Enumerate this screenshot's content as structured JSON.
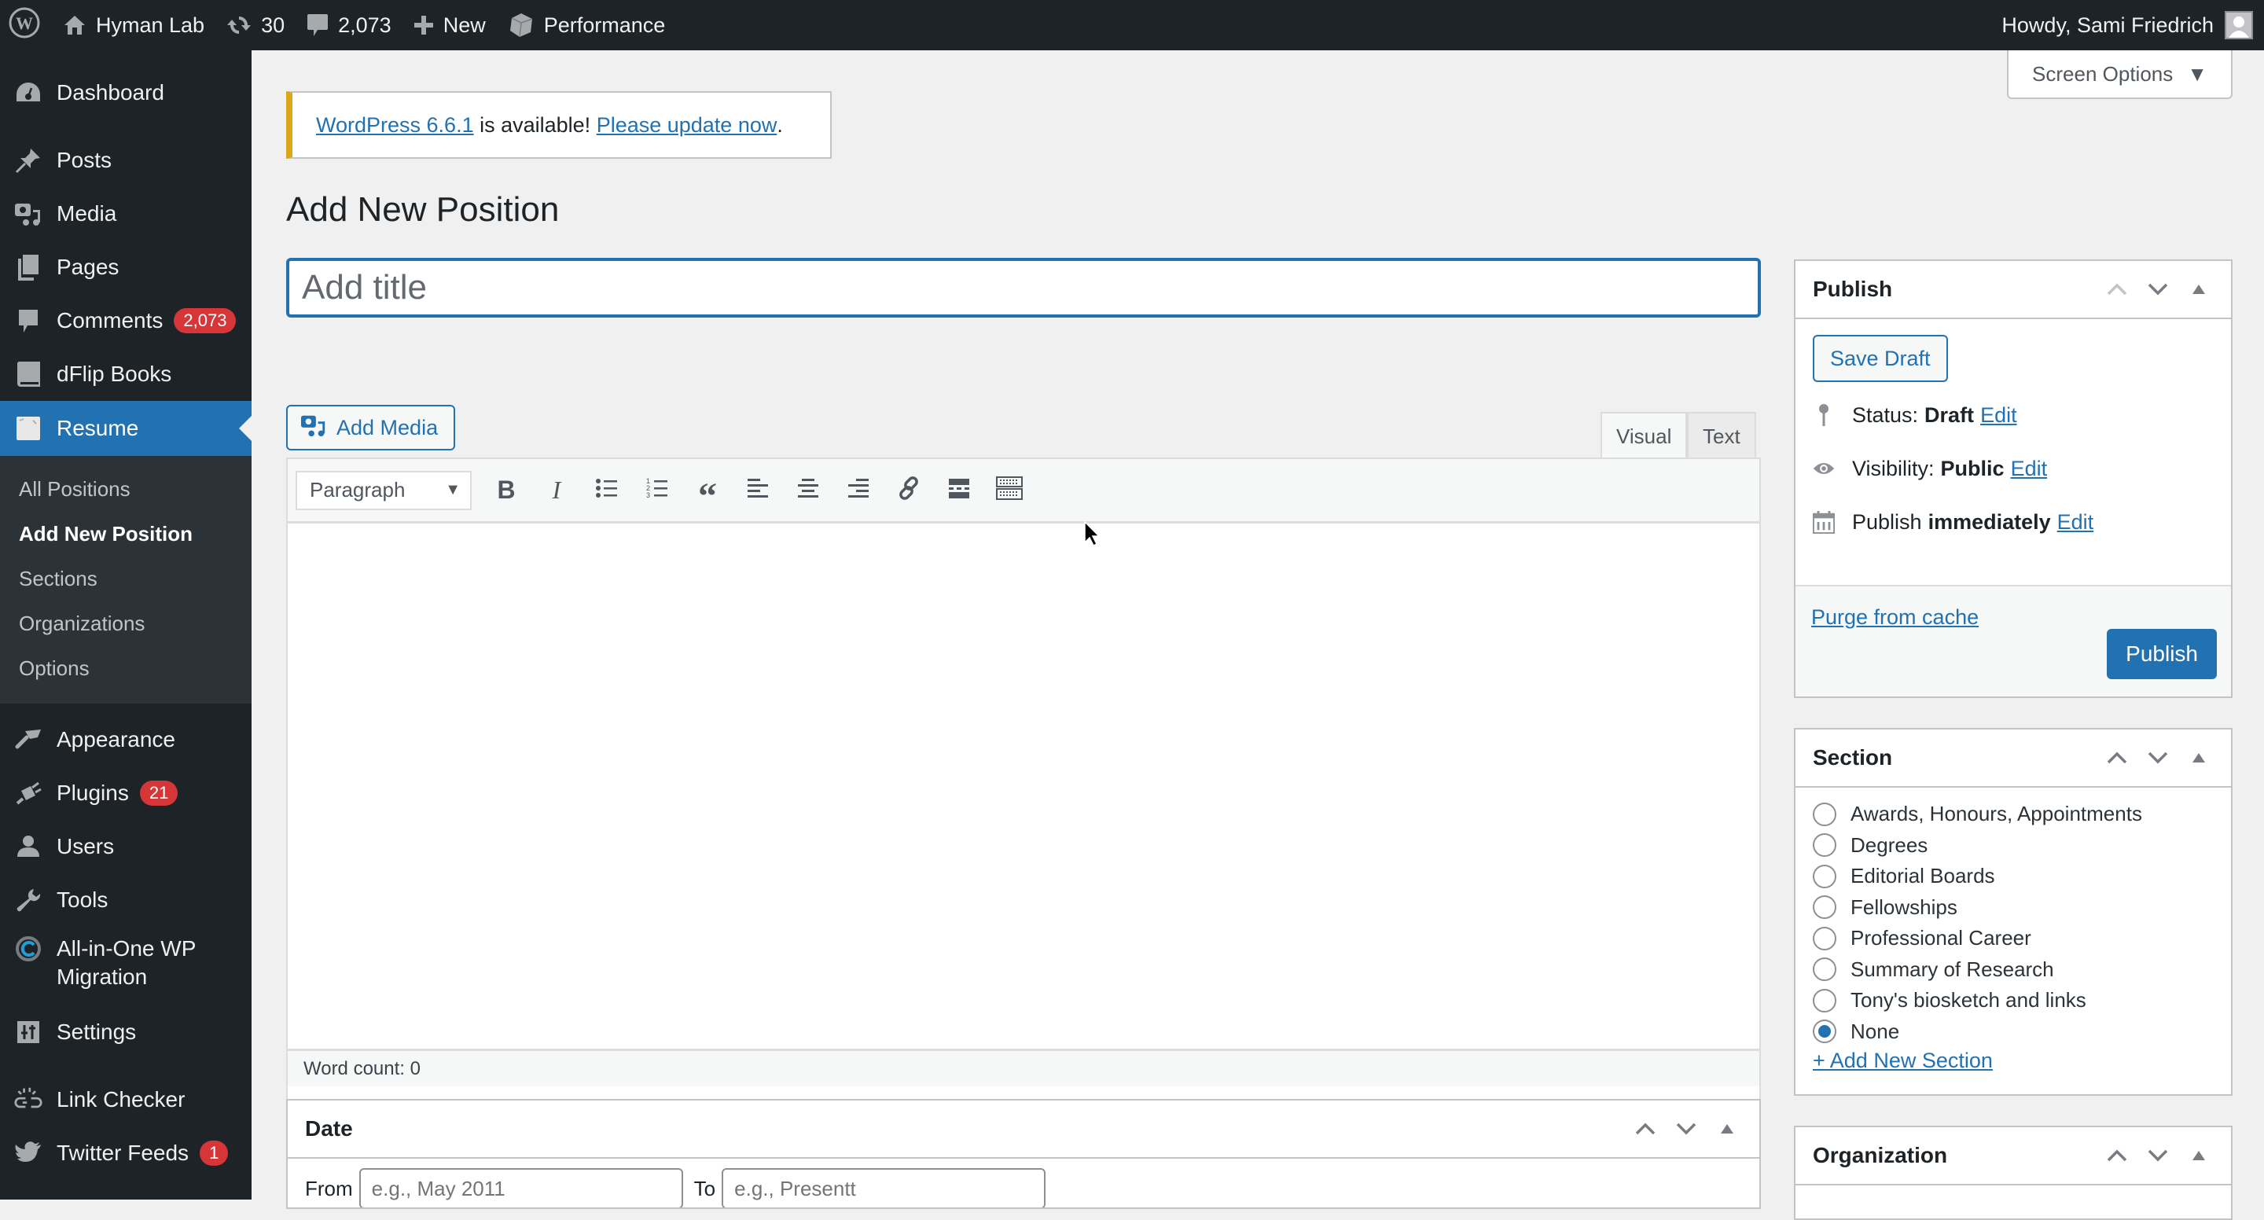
{
  "adminbar": {
    "site_name": "Hyman Lab",
    "updates_count": "30",
    "comments_count": "2,073",
    "new_label": "New",
    "performance_label": "Performance",
    "howdy": "Howdy, Sami Friedrich"
  },
  "sidebar": {
    "items": [
      {
        "label": "Dashboard",
        "icon": "dashboard-icon"
      },
      {
        "label": "Posts",
        "icon": "pushpin-icon"
      },
      {
        "label": "Media",
        "icon": "media-icon"
      },
      {
        "label": "Pages",
        "icon": "pages-icon"
      },
      {
        "label": "Comments",
        "icon": "comment-icon",
        "badge": "2,073"
      },
      {
        "label": "dFlip Books",
        "icon": "book-icon"
      },
      {
        "label": "Resume",
        "icon": "resume-icon",
        "current": true
      },
      {
        "label": "Appearance",
        "icon": "paintbrush-icon"
      },
      {
        "label": "Plugins",
        "icon": "plugin-icon",
        "badge": "21"
      },
      {
        "label": "Users",
        "icon": "user-icon"
      },
      {
        "label": "Tools",
        "icon": "wrench-icon"
      },
      {
        "label": "All-in-One WP Migration",
        "icon": "migration-icon"
      },
      {
        "label": "Settings",
        "icon": "settings-icon"
      },
      {
        "label": "Link Checker",
        "icon": "broken-link-icon"
      },
      {
        "label": "Twitter Feeds",
        "icon": "twitter-icon",
        "badge": "1"
      }
    ],
    "resume_submenu": [
      {
        "label": "All Positions"
      },
      {
        "label": "Add New Position",
        "active": true
      },
      {
        "label": "Sections"
      },
      {
        "label": "Organizations"
      },
      {
        "label": "Options"
      }
    ]
  },
  "screen_options": "Screen Options",
  "notice": {
    "link1": "WordPress 6.6.1",
    "text": " is available! ",
    "link2": "Please update now",
    "end": "."
  },
  "page_title": "Add New Position",
  "title_input": {
    "placeholder": "Add title",
    "value": ""
  },
  "editor": {
    "add_media": "Add Media",
    "tabs": [
      {
        "label": "Visual",
        "active": true
      },
      {
        "label": "Text"
      }
    ],
    "format_select": "Paragraph",
    "toolbar_buttons": [
      "bold",
      "italic",
      "bulleted-list",
      "numbered-list",
      "blockquote",
      "align-left",
      "align-center",
      "align-right",
      "insert-link",
      "read-more",
      "toolbar-toggle"
    ],
    "word_count": "Word count: 0"
  },
  "date_box": {
    "title": "Date",
    "from_label": "From",
    "from_placeholder": "e.g., May 2011",
    "to_label": "To",
    "to_placeholder": "e.g., Presentt"
  },
  "publish_box": {
    "title": "Publish",
    "save_draft": "Save Draft",
    "status_label": "Status:",
    "status_value": "Draft",
    "visibility_label": "Visibility:",
    "visibility_value": "Public",
    "schedule_label": "Publish",
    "schedule_value": "immediately",
    "edit": "Edit",
    "purge": "Purge from cache",
    "publish_button": "Publish"
  },
  "section_box": {
    "title": "Section",
    "options": [
      {
        "label": "Awards, Honours, Appointments",
        "checked": false
      },
      {
        "label": "Degrees",
        "checked": false
      },
      {
        "label": "Editorial Boards",
        "checked": false
      },
      {
        "label": "Fellowships",
        "checked": false
      },
      {
        "label": "Professional Career",
        "checked": false
      },
      {
        "label": "Summary of Research",
        "checked": false
      },
      {
        "label": "Tony's biosketch and links",
        "checked": false
      },
      {
        "label": "None",
        "checked": true
      }
    ],
    "add_new": "+ Add New Section"
  },
  "organization_box": {
    "title": "Organization"
  },
  "colors": {
    "accent": "#2271b1",
    "admin_bg": "#1d2327",
    "badge": "#d63638",
    "notice_warning": "#dba617"
  }
}
